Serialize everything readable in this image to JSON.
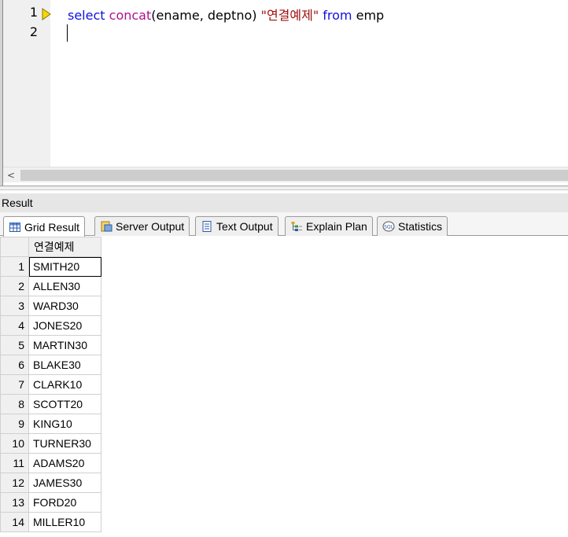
{
  "editor": {
    "line_numbers": [
      "1",
      "2"
    ],
    "code": {
      "kw_select": "select",
      "fn_concat": "concat",
      "args": "(ename, deptno) ",
      "alias": "\"연결예제\"",
      "kw_from": "from",
      "table": " emp"
    },
    "scroll_left": "<"
  },
  "result": {
    "title": "Result",
    "tabs": [
      {
        "label": "Grid Result",
        "icon": "grid-icon"
      },
      {
        "label": "Server Output",
        "icon": "server-output-icon"
      },
      {
        "label": "Text Output",
        "icon": "text-output-icon"
      },
      {
        "label": "Explain Plan",
        "icon": "explain-plan-icon"
      },
      {
        "label": "Statistics",
        "icon": "statistics-icon"
      }
    ],
    "grid": {
      "column": "연결예제",
      "rows": [
        {
          "n": "1",
          "v": "SMITH20"
        },
        {
          "n": "2",
          "v": "ALLEN30"
        },
        {
          "n": "3",
          "v": "WARD30"
        },
        {
          "n": "4",
          "v": "JONES20"
        },
        {
          "n": "5",
          "v": "MARTIN30"
        },
        {
          "n": "6",
          "v": "BLAKE30"
        },
        {
          "n": "7",
          "v": "CLARK10"
        },
        {
          "n": "8",
          "v": "SCOTT20"
        },
        {
          "n": "9",
          "v": "KING10"
        },
        {
          "n": "10",
          "v": "TURNER30"
        },
        {
          "n": "11",
          "v": "ADAMS20"
        },
        {
          "n": "12",
          "v": "JAMES30"
        },
        {
          "n": "13",
          "v": "FORD20"
        },
        {
          "n": "14",
          "v": "MILLER10"
        }
      ]
    }
  },
  "colors": {
    "keyword": "#1010e0",
    "function": "#b01090",
    "string": "#a01010",
    "marker": "#f5d800"
  }
}
